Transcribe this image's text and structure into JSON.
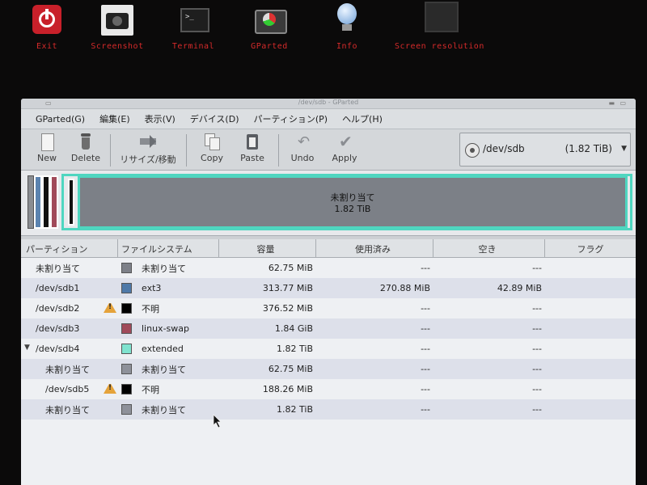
{
  "launchers": [
    {
      "label": "Exit",
      "icon": "power-icon"
    },
    {
      "label": "Screenshot",
      "icon": "camera-icon"
    },
    {
      "label": "Terminal",
      "icon": "terminal-icon"
    },
    {
      "label": "GParted",
      "icon": "gparted-icon"
    },
    {
      "label": "Info",
      "icon": "info-bulb-icon"
    },
    {
      "label": "Screen resolution",
      "icon": "monitor-icon"
    }
  ],
  "window": {
    "title": "/dev/sdb - GParted"
  },
  "menu": [
    "GParted(G)",
    "編集(E)",
    "表示(V)",
    "デバイス(D)",
    "パーティション(P)",
    "ヘルプ(H)"
  ],
  "toolbar": {
    "new": "New",
    "delete": "Delete",
    "resize": "リサイズ/移動",
    "copy": "Copy",
    "paste": "Paste",
    "undo": "Undo",
    "apply": "Apply"
  },
  "device": {
    "name": "/dev/sdb",
    "size": "(1.82 TiB)"
  },
  "map": {
    "label": "未割り当て",
    "size": "1.82 TiB"
  },
  "columns": [
    "パーティション",
    "ファイルシステム",
    "容量",
    "使用済み",
    "空き",
    "フラグ"
  ],
  "rows": [
    {
      "partition": "未割り当て",
      "fs": "未割り当て",
      "color": "#7d8088",
      "size": "62.75 MiB",
      "used": "---",
      "free": "---",
      "indent": 1,
      "warn": false
    },
    {
      "partition": "/dev/sdb1",
      "fs": "ext3",
      "color": "#4e79a8",
      "size": "313.77 MiB",
      "used": "270.88 MiB",
      "free": "42.89 MiB",
      "indent": 1,
      "warn": false
    },
    {
      "partition": "/dev/sdb2",
      "fs": "不明",
      "color": "#000000",
      "size": "376.52 MiB",
      "used": "---",
      "free": "---",
      "indent": 1,
      "warn": true
    },
    {
      "partition": "/dev/sdb3",
      "fs": "linux-swap",
      "color": "#a04a5a",
      "size": "1.84 GiB",
      "used": "---",
      "free": "---",
      "indent": 1,
      "warn": false
    },
    {
      "partition": "/dev/sdb4",
      "fs": "extended",
      "color": "#7fe3cf",
      "size": "1.82 TiB",
      "used": "---",
      "free": "---",
      "indent": 1,
      "warn": false,
      "expander": true
    },
    {
      "partition": "未割り当て",
      "fs": "未割り当て",
      "color": "#8e919a",
      "size": "62.75 MiB",
      "used": "---",
      "free": "---",
      "indent": 2,
      "warn": false
    },
    {
      "partition": "/dev/sdb5",
      "fs": "不明",
      "color": "#000000",
      "size": "188.26 MiB",
      "used": "---",
      "free": "---",
      "indent": 2,
      "warn": true
    },
    {
      "partition": "未割り当て",
      "fs": "未割り当て",
      "color": "#8e919a",
      "size": "1.82 TiB",
      "used": "---",
      "free": "---",
      "indent": 2,
      "warn": false
    }
  ]
}
